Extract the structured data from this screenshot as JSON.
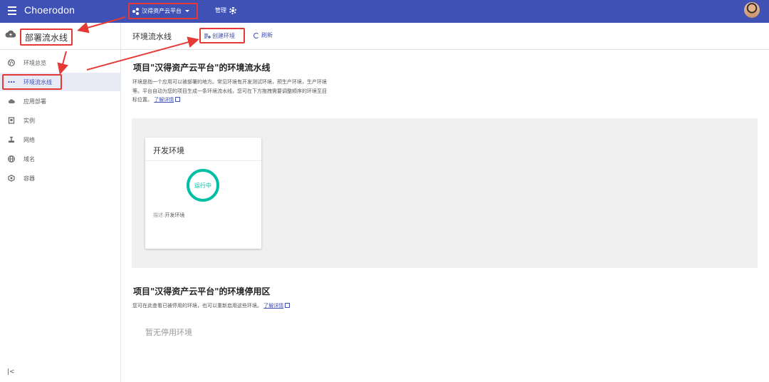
{
  "topbar": {
    "logo": "Choerodon",
    "project": "汉得资产云平台",
    "manage": "管理"
  },
  "sidebar": {
    "title": "部署流水线",
    "items": [
      {
        "label": "环境总览",
        "icon": "globe-icon"
      },
      {
        "label": "环境流水线",
        "icon": "more-horizontal-icon",
        "active": true
      },
      {
        "label": "应用部署",
        "icon": "cloud-deploy-icon"
      },
      {
        "label": "实例",
        "icon": "instance-icon"
      },
      {
        "label": "网络",
        "icon": "network-icon"
      },
      {
        "label": "域名",
        "icon": "domain-icon"
      },
      {
        "label": "容器",
        "icon": "container-icon"
      }
    ],
    "collapse": "|<"
  },
  "header": {
    "title": "环境流水线",
    "create": "创建环境",
    "refresh": "刷新"
  },
  "pipeline_section": {
    "title": "项目\"汉得资产云平台\"的环境流水线",
    "desc_lines": [
      "环境是指一个应用可以被部署的地方。常见环境有开发测试环境，预生产环境，生产环境",
      "等。平台自动为您的项目生成一条环境流水线，您可在下方拖拽需要调整顺序的环境至目",
      "标位置。"
    ],
    "learn_more": "了解详情"
  },
  "env_card": {
    "name": "开发环境",
    "status": "运行中",
    "desc_label": "描述:",
    "desc_value": "开发环境"
  },
  "disabled_section": {
    "title": "项目\"汉得资产云平台\"的环境停用区",
    "desc": "您可在此查看已被停用的环境，也可以重新启用这些环境。",
    "learn_more": "了解详情",
    "empty": "暂无停用环境"
  },
  "colors": {
    "primary": "#3f51b5",
    "running": "#00bfa5",
    "annotation": "#e53935"
  }
}
